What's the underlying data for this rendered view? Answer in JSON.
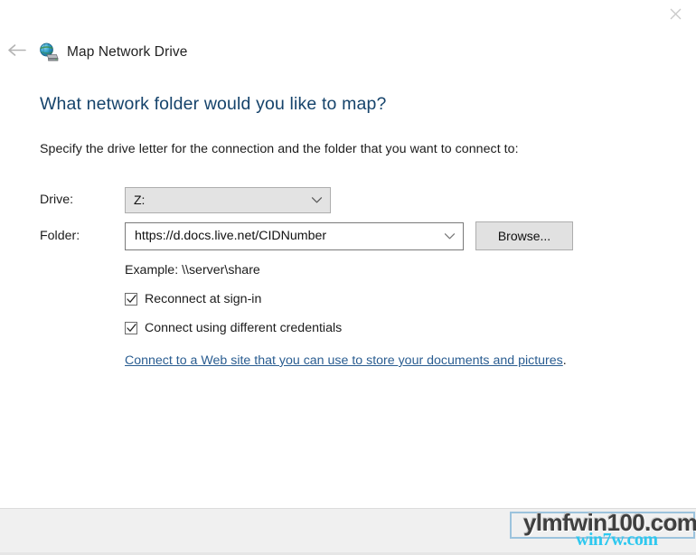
{
  "window": {
    "close_icon": "close-icon",
    "back_icon": "back-arrow-icon",
    "app_icon": "map-network-drive-icon",
    "title": "Map Network Drive"
  },
  "main": {
    "heading": "What network folder would you like to map?",
    "subtext": "Specify the drive letter for the connection and the folder that you want to connect to:",
    "drive": {
      "label": "Drive:",
      "value": "Z:",
      "chevron_icon": "chevron-down-icon"
    },
    "folder": {
      "label": "Folder:",
      "value": "https://d.docs.live.net/CIDNumber",
      "placeholder": "",
      "chevron_icon": "chevron-down-icon",
      "browse_label": "Browse..."
    },
    "example": "Example: \\\\server\\share",
    "checkboxes": [
      {
        "label": "Reconnect at sign-in",
        "checked": true
      },
      {
        "label": "Connect using different credentials",
        "checked": true
      }
    ],
    "link": {
      "text": "Connect to a Web site that you can use to store your documents and pictures",
      "trailing": "."
    }
  },
  "watermark": {
    "primary": "ylmfwin100.com",
    "secondary": "win7w.com",
    "box_color": "#9cc3dd",
    "secondary_color": "#2ec8ef"
  },
  "colors": {
    "heading": "#15436b",
    "link": "#2a5d91",
    "footer_bg": "#f0f0f0"
  }
}
